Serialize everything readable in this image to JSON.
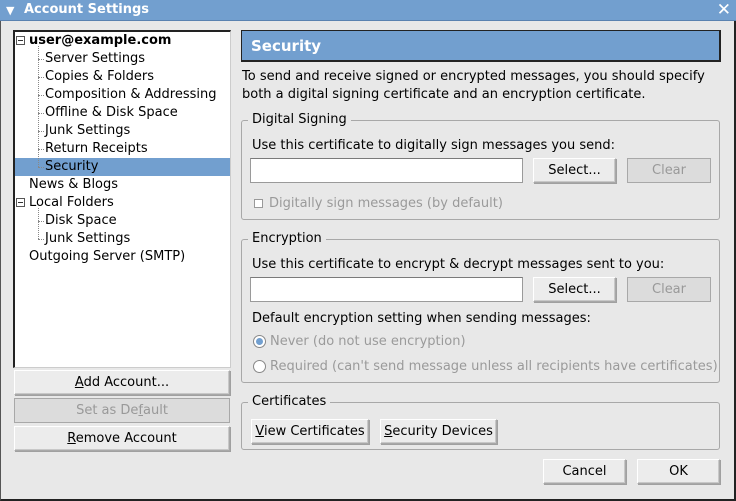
{
  "window": {
    "title": "Account Settings",
    "close_glyph": "✕",
    "menu_glyph": "▼"
  },
  "tree": {
    "items": [
      {
        "label": "user@example.com",
        "level": 0,
        "expanded": true,
        "bold": true
      },
      {
        "label": "Server Settings",
        "level": 1
      },
      {
        "label": "Copies & Folders",
        "level": 1
      },
      {
        "label": "Composition & Addressing",
        "level": 1
      },
      {
        "label": "Offline & Disk Space",
        "level": 1
      },
      {
        "label": "Junk Settings",
        "level": 1
      },
      {
        "label": "Return Receipts",
        "level": 1
      },
      {
        "label": "Security",
        "level": 1,
        "selected": true
      },
      {
        "label": "News & Blogs",
        "level": 0
      },
      {
        "label": "Local Folders",
        "level": 0,
        "expanded": true
      },
      {
        "label": "Disk Space",
        "level": 1
      },
      {
        "label": "Junk Settings",
        "level": 1
      },
      {
        "label": "Outgoing Server (SMTP)",
        "level": 0
      }
    ]
  },
  "left_buttons": {
    "add_account": {
      "pre": "",
      "mnemonic": "A",
      "post": "dd Account..."
    },
    "set_default": {
      "pre": "Set as De",
      "mnemonic": "f",
      "post": "ault"
    },
    "remove_account": {
      "pre": "",
      "mnemonic": "R",
      "post": "emove Account"
    }
  },
  "panel": {
    "title": "Security",
    "intro": "To send and receive signed or encrypted messages, you should specify both a digital signing certificate and an encryption certificate.",
    "signing": {
      "legend": "Digital Signing",
      "label": "Use this certificate to digitally sign messages you send:",
      "value": "",
      "select_label": "Select...",
      "clear_label": "Clear",
      "checkbox_label": "Digitally sign messages (by default)",
      "checkbox_checked": false
    },
    "encryption": {
      "legend": "Encryption",
      "label": "Use this certificate to encrypt & decrypt messages sent to you:",
      "value": "",
      "select_label": "Select...",
      "clear_label": "Clear",
      "default_label": "Default encryption setting when sending messages:",
      "options": [
        {
          "label": "Never (do not use encryption)",
          "selected": true
        },
        {
          "label": "Required (can't send message unless all recipients have certificates)",
          "selected": false
        }
      ]
    },
    "certificates": {
      "legend": "Certificates",
      "view": {
        "mnemonic": "V",
        "post": "iew Certificates"
      },
      "devices": {
        "mnemonic": "S",
        "post": "ecurity Devices"
      }
    }
  },
  "footer": {
    "cancel_label": "Cancel",
    "ok_label": "OK"
  }
}
